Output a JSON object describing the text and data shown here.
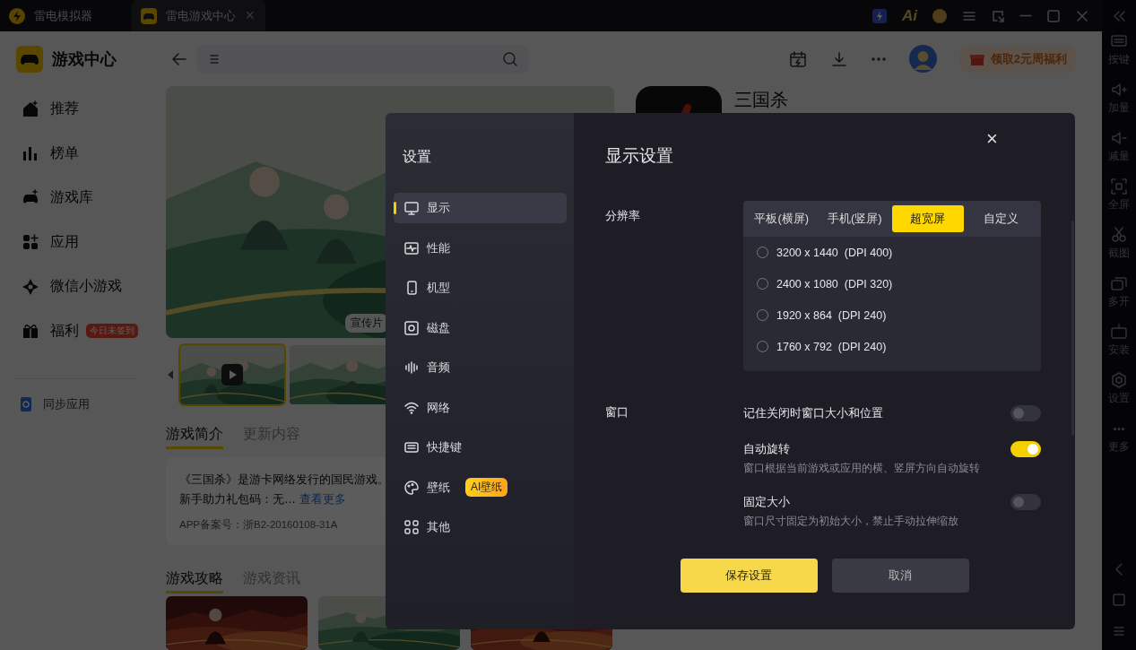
{
  "titlebar": {
    "tabs": [
      {
        "label": "雷电模拟器",
        "selected": false
      },
      {
        "label": "雷电游戏中心",
        "selected": true
      }
    ],
    "tab_close": "×",
    "ai_label": "Ai"
  },
  "right_toolbar": {
    "items": [
      {
        "label": "按键"
      },
      {
        "label": "加量"
      },
      {
        "label": "减量"
      },
      {
        "label": "全屏"
      },
      {
        "label": "截图"
      },
      {
        "label": "多开"
      },
      {
        "label": "安装"
      },
      {
        "label": "设置"
      },
      {
        "label": "更多"
      }
    ]
  },
  "sidebar": {
    "title": "游戏中心",
    "items": [
      {
        "label": "推荐"
      },
      {
        "label": "榜单"
      },
      {
        "label": "游戏库"
      },
      {
        "label": "应用"
      },
      {
        "label": "微信小游戏"
      },
      {
        "label": "福利",
        "badge": "今日未签到"
      }
    ],
    "sync": "同步应用"
  },
  "topbar": {
    "promo": "领取2元周福利"
  },
  "game": {
    "title": "三国杀",
    "video_label": "宣传片",
    "intro_tabs": [
      {
        "label": "游戏简介",
        "selected": true
      },
      {
        "label": "更新内容",
        "selected": false
      }
    ],
    "description": "《三国杀》是游卡网络发行的国民游戏。",
    "gift": "新手助力礼包码：无…",
    "more_link": "查看更多",
    "license": "APP备案号：浙B2-20160108-31A",
    "guide_tabs": [
      {
        "label": "游戏攻略",
        "selected": true
      },
      {
        "label": "游戏资讯",
        "selected": false
      }
    ]
  },
  "settings": {
    "title": "设置",
    "menu": [
      {
        "label": "显示",
        "selected": true
      },
      {
        "label": "性能",
        "selected": false
      },
      {
        "label": "机型",
        "selected": false
      },
      {
        "label": "磁盘",
        "selected": false
      },
      {
        "label": "音频",
        "selected": false
      },
      {
        "label": "网络",
        "selected": false
      },
      {
        "label": "快捷键",
        "selected": false
      },
      {
        "label": "壁纸",
        "selected": false,
        "badge": "AI壁纸"
      },
      {
        "label": "其他",
        "selected": false
      }
    ],
    "heading": "显示设置",
    "close": "×",
    "resolution": {
      "label": "分辨率",
      "tabs": [
        {
          "label": "平板(横屏)",
          "selected": false
        },
        {
          "label": "手机(竖屏)",
          "selected": false
        },
        {
          "label": "超宽屏",
          "selected": true
        },
        {
          "label": "自定义",
          "selected": false
        }
      ],
      "options": [
        {
          "label": "3200 x 1440  (DPI 400)",
          "selected": false
        },
        {
          "label": "2400 x 1080  (DPI 320)",
          "selected": false
        },
        {
          "label": "1920 x 864  (DPI 240)",
          "selected": false
        },
        {
          "label": "1760 x 792  (DPI 240)",
          "selected": false
        }
      ]
    },
    "window": {
      "label": "窗口",
      "toggles": [
        {
          "label": "记住关闭时窗口大小和位置",
          "on": false
        },
        {
          "label": "自动旋转",
          "on": true,
          "hint": "窗口根据当前游戏或应用的横、竖屏方向自动旋转"
        },
        {
          "label": "固定大小",
          "on": false,
          "hint": "窗口尺寸固定为初始大小，禁止手动拉伸缩放"
        }
      ]
    },
    "buttons": [
      {
        "label": "保存设置",
        "kind": "primary"
      },
      {
        "label": "取消",
        "kind": "secondary"
      }
    ]
  }
}
